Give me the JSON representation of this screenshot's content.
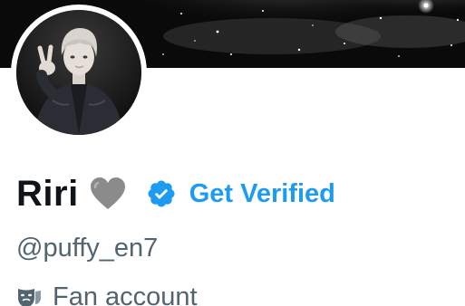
{
  "profile": {
    "display_name": "Riri",
    "name_emoji": "grey-heart-icon",
    "verified_icon": "verified-badge-icon",
    "get_verified_label": "Get Verified",
    "handle": "@puffy_en7",
    "category_icon": "performing-arts-mask-icon",
    "category_label": "Fan account"
  },
  "colors": {
    "accent": "#1d9bf0",
    "primary_text": "#0f1419",
    "secondary_text": "#536471",
    "heart": "#8b8b8b"
  }
}
